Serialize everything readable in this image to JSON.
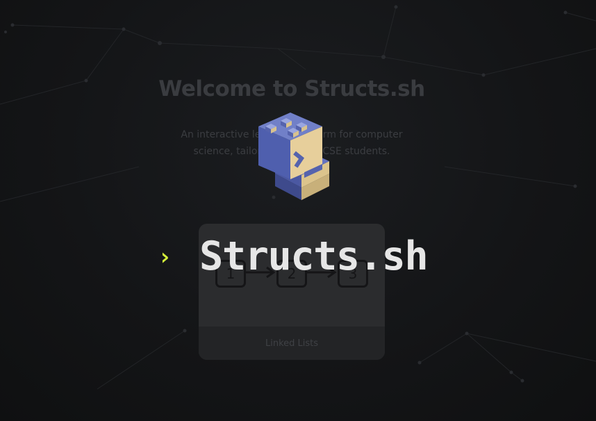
{
  "background": {
    "title": "Welcome to Structs.sh",
    "subtitle": "An interactive learning platform for computer science, tailored to UNSW CSE students.",
    "card": {
      "label": "Linked Lists",
      "nodes": [
        "1",
        "2",
        "3"
      ]
    }
  },
  "splash": {
    "logo_icon": "stacked-blocks-logo-icon",
    "prompt_symbol": "›",
    "brand": "Structs.sh"
  },
  "colors": {
    "accent": "#d4f03a",
    "brand_text": "#e6e6e6",
    "logo_blue": "#4f5fae",
    "logo_tan": "#e7cf9b",
    "page_bg": "#131416"
  }
}
